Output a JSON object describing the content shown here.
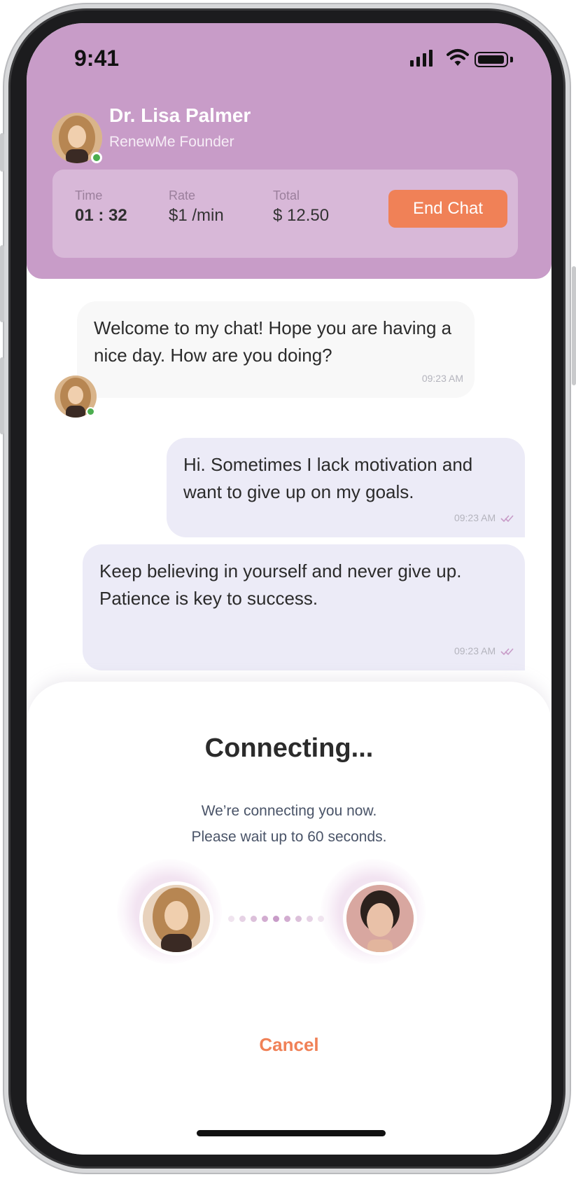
{
  "status_bar": {
    "time": "9:41"
  },
  "header": {
    "doctor_name": "Dr. Lisa Palmer",
    "doctor_role": "RenewMe Founder",
    "stats": [
      {
        "label": "Time",
        "value": "01 : 32"
      },
      {
        "label": "Rate",
        "value": "$1 /min"
      },
      {
        "label": "Total",
        "value": "$ 12.50"
      }
    ],
    "end_chat_label": "End Chat"
  },
  "messages": [
    {
      "sender": "doctor",
      "text": "Welcome to my chat! Hope you are having a nice day. How are you doing?",
      "time": "09:23 AM"
    },
    {
      "sender": "user",
      "text": "Hi. Sometimes I lack motivation and want to give up on my goals.",
      "time": "09:23 AM"
    },
    {
      "sender": "user",
      "text": "Keep believing in yourself and never give up. Patience is key to success.",
      "time": "09:23 AM"
    }
  ],
  "connecting": {
    "title": "Connecting...",
    "line1": "We’re connecting you now.",
    "line2": "Please wait up to 60 seconds.",
    "cancel_label": "Cancel"
  },
  "colors": {
    "header": "#c89cc8",
    "accent": "#f08157",
    "user_bubble": "#ecebf7",
    "doctor_bubble": "#f8f8f8",
    "online": "#4cae4f"
  },
  "icons": [
    "signal-icon",
    "wifi-icon",
    "battery-icon",
    "double-check-icon"
  ]
}
